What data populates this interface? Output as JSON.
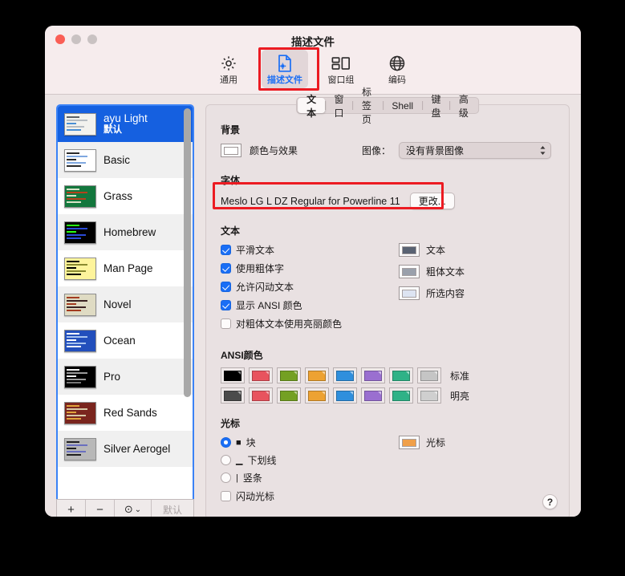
{
  "window": {
    "title": "描述文件",
    "traffic": [
      "close",
      "minimize",
      "maximize"
    ]
  },
  "toolbar": {
    "items": [
      {
        "label": "通用",
        "icon": "gear-icon",
        "selected": false
      },
      {
        "label": "描述文件",
        "icon": "document-gear-icon",
        "selected": true
      },
      {
        "label": "窗口组",
        "icon": "window-group-icon",
        "selected": false
      },
      {
        "label": "编码",
        "icon": "globe-icon",
        "selected": false
      }
    ]
  },
  "sidebar": {
    "profiles": [
      {
        "name": "ayu Light",
        "sub": "默认",
        "selected": true,
        "bg": "#f2f2ee",
        "fg": "#5c6166",
        "accent": "#4a8fd4"
      },
      {
        "name": "Basic",
        "sub": "",
        "selected": false,
        "bg": "#ffffff",
        "fg": "#2b2b2b",
        "accent": "#7fa8e0"
      },
      {
        "name": "Grass",
        "sub": "",
        "selected": false,
        "bg": "#13773d",
        "fg": "#d7e3c8",
        "accent": "#b5421c"
      },
      {
        "name": "Homebrew",
        "sub": "",
        "selected": false,
        "bg": "#000000",
        "fg": "#28fe14",
        "accent": "#2a4ad7"
      },
      {
        "name": "Man Page",
        "sub": "",
        "selected": false,
        "bg": "#fef49c",
        "fg": "#000000",
        "accent": "#8a8a30"
      },
      {
        "name": "Novel",
        "sub": "",
        "selected": false,
        "bg": "#dfdbc3",
        "fg": "#3b2322",
        "accent": "#a33b20"
      },
      {
        "name": "Ocean",
        "sub": "",
        "selected": false,
        "bg": "#224fbc",
        "fg": "#ffffff",
        "accent": "#7fa8e0"
      },
      {
        "name": "Pro",
        "sub": "",
        "selected": false,
        "bg": "#000000",
        "fg": "#f2f2f2",
        "accent": "#9a9a9a"
      },
      {
        "name": "Red Sands",
        "sub": "",
        "selected": false,
        "bg": "#7a251e",
        "fg": "#d7c9a7",
        "accent": "#e0a33b"
      },
      {
        "name": "Silver Aerogel",
        "sub": "",
        "selected": false,
        "bg": "#b8b8b8",
        "fg": "#1f1f1f",
        "accent": "#6a6fbf"
      }
    ],
    "toolbar": {
      "add": "+",
      "remove": "−",
      "action": "⊙",
      "action_chevron": "⌄",
      "default_label": "默认"
    }
  },
  "main": {
    "tabs": [
      {
        "label": "文本",
        "active": true
      },
      {
        "label": "窗口",
        "active": false
      },
      {
        "label": "标签页",
        "active": false
      },
      {
        "label": "Shell",
        "active": false
      },
      {
        "label": "键盘",
        "active": false
      },
      {
        "label": "高级",
        "active": false
      }
    ],
    "background": {
      "title": "背景",
      "color_effects_label": "颜色与效果",
      "color_swatch": "#ffffff",
      "image_label": "图像：",
      "image_value": "没有背景图像"
    },
    "font": {
      "title": "字体",
      "value": "Meslo LG L DZ Regular for Powerline 11",
      "change_button": "更改..."
    },
    "text": {
      "title": "文本",
      "checkboxes": [
        {
          "label": "平滑文本",
          "checked": true
        },
        {
          "label": "使用粗体字",
          "checked": true
        },
        {
          "label": "允许闪动文本",
          "checked": true
        },
        {
          "label": "显示 ANSI 颜色",
          "checked": true
        },
        {
          "label": "对粗体文本使用亮丽颜色",
          "checked": false
        }
      ],
      "colors": [
        {
          "label": "文本",
          "color": "#596272"
        },
        {
          "label": "粗体文本",
          "color": "#9aa0ab"
        },
        {
          "label": "所选内容",
          "color": "#dde4f2"
        }
      ]
    },
    "ansi": {
      "title": "ANSI颜色",
      "rows": [
        {
          "label": "标准",
          "colors": [
            "#000000",
            "#e8535e",
            "#74a023",
            "#eda232",
            "#2f8fdd",
            "#9a6fd0",
            "#2fb287",
            "#c5c5c5"
          ]
        },
        {
          "label": "明亮",
          "colors": [
            "#4b4b4b",
            "#e8535e",
            "#74a023",
            "#eda232",
            "#2f8fdd",
            "#9a6fd0",
            "#2fb287",
            "#cfcfcf"
          ]
        }
      ]
    },
    "cursor": {
      "title": "光标",
      "options": [
        {
          "label": "块",
          "glyph": "■",
          "selected": true
        },
        {
          "label": "下划线",
          "glyph": "▁",
          "selected": false
        },
        {
          "label": "竖条",
          "glyph": "|",
          "selected": false
        }
      ],
      "blink": {
        "label": "闪动光标",
        "checked": false
      },
      "color_label": "光标",
      "color": "#f0a049"
    },
    "help_button": "?"
  },
  "highlights": {
    "accent": "#ec1b22",
    "regions": [
      "toolbar-profile-tab",
      "font-row"
    ]
  }
}
